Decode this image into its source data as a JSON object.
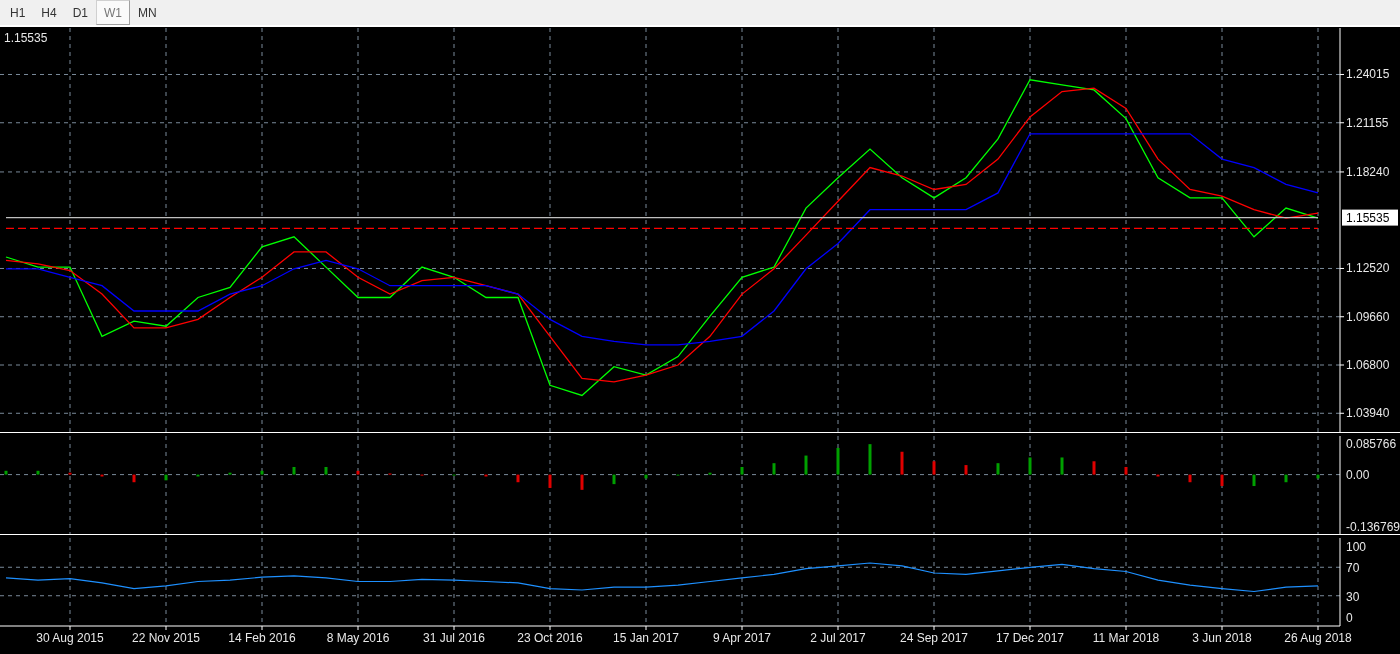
{
  "timeframe_tabs": [
    {
      "label": "H1",
      "selected": false
    },
    {
      "label": "H4",
      "selected": false
    },
    {
      "label": "D1",
      "selected": false
    },
    {
      "label": "W1",
      "selected": true
    },
    {
      "label": "MN",
      "selected": false
    }
  ],
  "main": {
    "price_label": "1.15535",
    "current_price_tag": "1.15535",
    "chart_data": {
      "type": "line",
      "grid": true,
      "ylim": [
        1.0283,
        1.2677
      ],
      "yticks": [
        {
          "value": 1.24015,
          "label": "1.24015"
        },
        {
          "value": 1.21155,
          "label": "1.21155"
        },
        {
          "value": 1.1824,
          "label": "1.18240"
        },
        {
          "value": 1.1252,
          "label": "1.12520"
        },
        {
          "value": 1.0966,
          "label": "1.09660"
        },
        {
          "value": 1.068,
          "label": "1.06800"
        },
        {
          "value": 1.0394,
          "label": "1.03940"
        }
      ],
      "series": [
        {
          "color": "#00ff00",
          "values": [
            1.132,
            1.126,
            1.126,
            1.085,
            1.094,
            1.091,
            1.108,
            1.114,
            1.138,
            1.144,
            1.126,
            1.108,
            1.108,
            1.126,
            1.12,
            1.108,
            1.108,
            1.056,
            1.05,
            1.067,
            1.062,
            1.073,
            1.097,
            1.12,
            1.126,
            1.161,
            1.179,
            1.196,
            1.179,
            1.167,
            1.179,
            1.202,
            1.237,
            1.234,
            1.231,
            1.214,
            1.179,
            1.167,
            1.167,
            1.144,
            1.161,
            1.155
          ]
        },
        {
          "color": "#ff0000",
          "values": [
            1.13,
            1.128,
            1.124,
            1.11,
            1.09,
            1.09,
            1.095,
            1.108,
            1.12,
            1.135,
            1.135,
            1.12,
            1.11,
            1.118,
            1.12,
            1.115,
            1.11,
            1.085,
            1.06,
            1.058,
            1.062,
            1.068,
            1.085,
            1.11,
            1.125,
            1.145,
            1.165,
            1.185,
            1.18,
            1.172,
            1.175,
            1.19,
            1.215,
            1.23,
            1.232,
            1.22,
            1.19,
            1.172,
            1.168,
            1.16,
            1.155,
            1.158
          ]
        },
        {
          "color": "#0000ff",
          "values": [
            1.125,
            1.125,
            1.12,
            1.115,
            1.1,
            1.1,
            1.1,
            1.11,
            1.115,
            1.125,
            1.13,
            1.125,
            1.115,
            1.115,
            1.115,
            1.115,
            1.11,
            1.095,
            1.085,
            1.082,
            1.08,
            1.08,
            1.082,
            1.085,
            1.1,
            1.125,
            1.14,
            1.16,
            1.16,
            1.16,
            1.16,
            1.17,
            1.205,
            1.205,
            1.205,
            1.205,
            1.205,
            1.205,
            1.19,
            1.185,
            1.175,
            1.17
          ]
        },
        {
          "color": "#ff0000",
          "line_style": "dashed",
          "values": [
            1.149,
            1.149,
            1.149,
            1.149,
            1.149,
            1.149,
            1.149,
            1.149,
            1.149,
            1.149,
            1.149,
            1.149,
            1.149,
            1.149,
            1.149,
            1.149,
            1.149,
            1.149,
            1.149,
            1.149,
            1.149,
            1.149,
            1.149,
            1.149,
            1.149,
            1.149,
            1.149,
            1.149,
            1.149,
            1.149,
            1.149,
            1.149,
            1.149,
            1.149,
            1.149,
            1.149,
            1.149,
            1.149,
            1.149,
            1.149,
            1.149,
            1.149
          ]
        },
        {
          "color": "#c0c0c0",
          "values": [
            1.15535,
            1.15535,
            1.15535,
            1.15535,
            1.15535,
            1.15535,
            1.15535,
            1.15535,
            1.15535,
            1.15535,
            1.15535,
            1.15535,
            1.15535,
            1.15535,
            1.15535,
            1.15535,
            1.15535,
            1.15535,
            1.15535,
            1.15535,
            1.15535,
            1.15535,
            1.15535,
            1.15535,
            1.15535,
            1.15535,
            1.15535,
            1.15535,
            1.15535,
            1.15535,
            1.15535,
            1.15535,
            1.15535,
            1.15535,
            1.15535,
            1.15535,
            1.15535,
            1.15535,
            1.15535,
            1.15535,
            1.15535,
            1.15535
          ]
        }
      ]
    }
  },
  "oscillator": {
    "chart_data": {
      "type": "bar",
      "grid": true,
      "ylim": [
        -0.156,
        0.1014
      ],
      "yticks": [
        {
          "value": 0.085766,
          "label": "0.085766"
        },
        {
          "value": 0,
          "label": "0.00"
        },
        {
          "value": -0.136769,
          "label": "-0.136769"
        }
      ],
      "values": [
        0.01,
        0.01,
        0.005,
        -0.005,
        -0.02,
        -0.015,
        -0.005,
        0.005,
        0.01,
        0.02,
        0.02,
        0.01,
        0.003,
        0.0,
        0.0,
        -0.005,
        -0.02,
        -0.035,
        -0.04,
        -0.025,
        -0.01,
        0.0,
        0.005,
        0.02,
        0.03,
        0.05,
        0.07,
        0.08,
        0.06,
        0.035,
        0.025,
        0.03,
        0.045,
        0.045,
        0.035,
        0.02,
        -0.005,
        -0.02,
        -0.03,
        -0.03,
        -0.02,
        -0.01
      ]
    }
  },
  "rsi": {
    "chart_data": {
      "type": "line",
      "grid": true,
      "categories": [
        null,
        null,
        "30 Aug 2015",
        null,
        null,
        "22 Nov 2015",
        null,
        null,
        "14 Feb 2016",
        null,
        null,
        "8 May 2016",
        null,
        null,
        "31 Jul 2016",
        null,
        null,
        "23 Oct 2016",
        null,
        null,
        "15 Jan 2017",
        null,
        null,
        "9 Apr 2017",
        null,
        null,
        "2 Jul 2017",
        null,
        null,
        "24 Sep 2017",
        null,
        null,
        "17 Dec 2017",
        null,
        null,
        "11 Mar 2018",
        null,
        null,
        "3 Jun 2018",
        null,
        null,
        "26 Aug 2018"
      ],
      "ylim": [
        -12.5,
        111.1
      ],
      "yticks": [
        100,
        70,
        30,
        0
      ],
      "series": [
        {
          "color": "#1e90ff",
          "values": [
            55,
            52,
            54,
            48,
            40,
            44,
            50,
            52,
            56,
            58,
            55,
            50,
            50,
            53,
            52,
            50,
            48,
            40,
            38,
            42,
            42,
            45,
            50,
            55,
            60,
            68,
            72,
            76,
            72,
            62,
            60,
            65,
            70,
            74,
            68,
            64,
            52,
            45,
            40,
            36,
            42,
            44
          ]
        }
      ]
    }
  }
}
